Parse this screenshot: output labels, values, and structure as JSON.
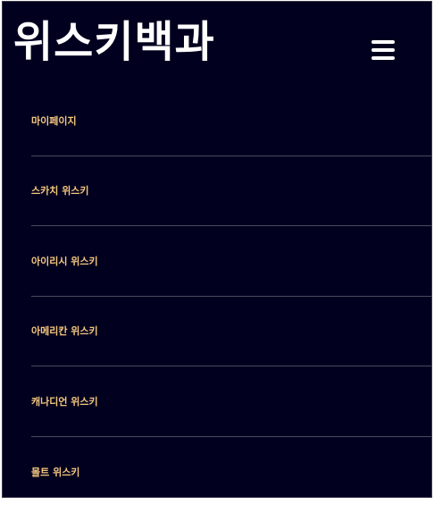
{
  "header": {
    "brand": "위스키백과",
    "menu_icon": "hamburger-menu-icon"
  },
  "nav": {
    "items": [
      {
        "label": "마이페이지"
      },
      {
        "label": "스카치 위스키"
      },
      {
        "label": "아이리시 위스키"
      },
      {
        "label": "아메리칸 위스키"
      },
      {
        "label": "캐나디언 위스키"
      },
      {
        "label": "몰트 위스키"
      }
    ]
  },
  "colors": {
    "panel_background": "#02001f",
    "brand_text": "#ffffff",
    "menu_text": "#f5c77e",
    "divider": "#4a4a5e"
  }
}
